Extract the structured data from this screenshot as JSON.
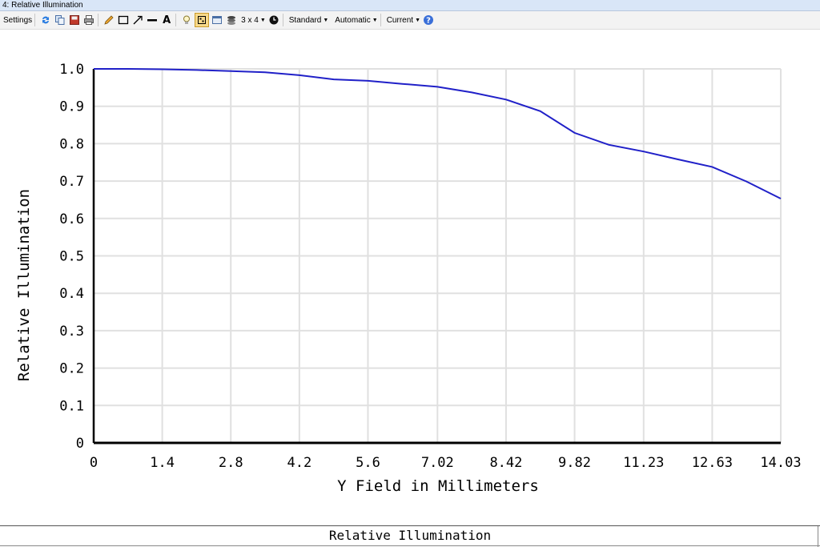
{
  "window": {
    "title": "4: Relative Illumination"
  },
  "toolbar": {
    "settings_label": "Settings",
    "layout_label": "3 x 4",
    "standard_label": "Standard",
    "automatic_label": "Automatic",
    "current_label": "Current",
    "icons": [
      "refresh-icon",
      "copy-icon",
      "save-icon",
      "print-icon",
      "pencil-icon",
      "rectangle-icon",
      "arrow-icon",
      "line-icon",
      "text-icon",
      "bulb-icon",
      "grid-select-icon",
      "window-icon",
      "layers-icon",
      "clock-icon",
      "help-icon"
    ]
  },
  "colors": {
    "line": "#2020c8",
    "grid": "#e0e0e0",
    "axis": "#000000",
    "accent": "#3a6fd8"
  },
  "chart_data": {
    "type": "line",
    "title": "",
    "xlabel": "Y Field in Millimeters",
    "ylabel": "Relative Illumination",
    "xlim": [
      0,
      14.03
    ],
    "ylim": [
      0,
      1.0
    ],
    "x_ticks": [
      0,
      1.4,
      2.8,
      4.2,
      5.6,
      7.02,
      8.42,
      9.82,
      11.23,
      12.63,
      14.03
    ],
    "x_tick_labels": [
      "0",
      "1.4",
      "2.8",
      "4.2",
      "5.6",
      "7.02",
      "8.42",
      "9.82",
      "11.23",
      "12.63",
      "14.03"
    ],
    "y_ticks": [
      0,
      0.1,
      0.2,
      0.3,
      0.4,
      0.5,
      0.6,
      0.7,
      0.8,
      0.9,
      1.0
    ],
    "y_tick_labels": [
      "0",
      "0.1",
      "0.2",
      "0.3",
      "0.4",
      "0.5",
      "0.6",
      "0.7",
      "0.8",
      "0.9",
      "1.0"
    ],
    "grid": true,
    "series": [
      {
        "x": [
          0,
          0.7,
          1.4,
          2.1,
          2.8,
          3.5,
          4.2,
          4.9,
          5.6,
          6.3,
          7.02,
          7.72,
          8.42,
          9.12,
          9.82,
          10.52,
          11.23,
          11.93,
          12.63,
          13.33,
          14.03
        ],
        "values": [
          1.0,
          1.0,
          0.999,
          0.997,
          0.994,
          0.991,
          0.983,
          0.972,
          0.968,
          0.96,
          0.952,
          0.937,
          0.918,
          0.887,
          0.829,
          0.797,
          0.779,
          0.758,
          0.738,
          0.699,
          0.653
        ]
      }
    ]
  },
  "footer": {
    "caption": "Relative Illumination"
  }
}
